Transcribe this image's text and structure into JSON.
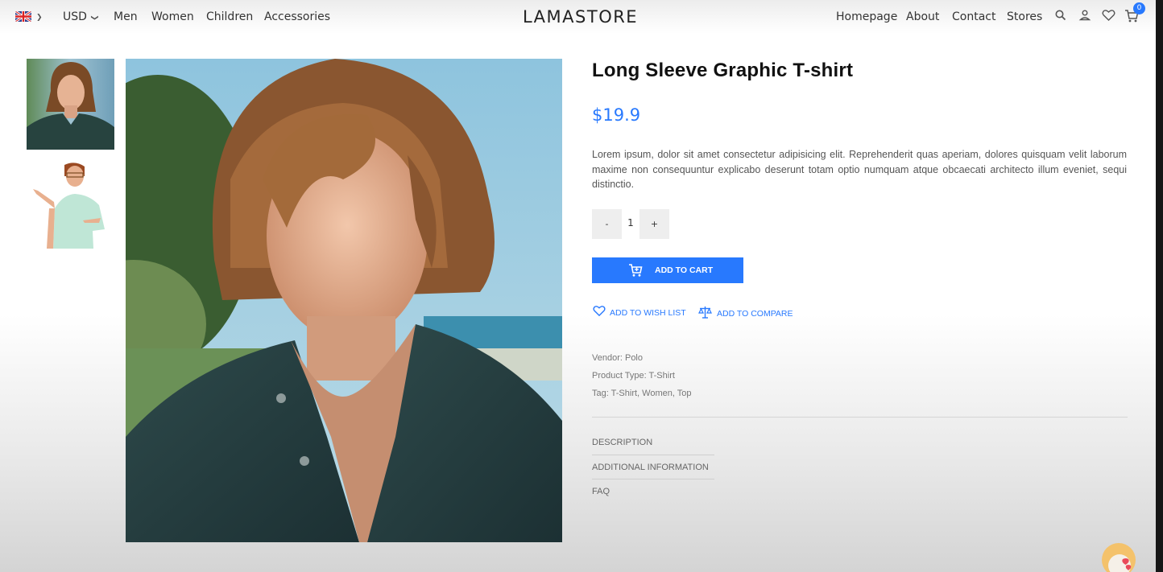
{
  "colors": {
    "accent": "#2879fe",
    "title": "#111111",
    "text": "#555555"
  },
  "nav": {
    "flag_icon": "uk-flag-icon",
    "currency": "USD",
    "left_links": [
      "Men",
      "Women",
      "Children",
      "Accessories"
    ],
    "logo": "LAMASTORE",
    "right_links": [
      "Homepage",
      "About",
      "Contact",
      "Stores"
    ],
    "icons": [
      "search-icon",
      "user-icon",
      "heart-icon",
      "cart-icon"
    ],
    "cart_count": "0"
  },
  "gallery": {
    "thumbnails": [
      "thumb-man-long-hair",
      "thumb-man-pointing"
    ],
    "main_image": "man-long-hair-dark-shirt"
  },
  "product": {
    "title": "Long Sleeve Graphic T-shirt",
    "price": "$19.9",
    "description": "Lorem ipsum, dolor sit amet consectetur adipisicing elit. Reprehenderit quas aperiam, dolores quisquam velit laborum maxime non consequuntur explicabo deserunt totam optio numquam atque obcaecati architecto illum eveniet, sequi distinctio.",
    "qty_minus": "-",
    "quantity": "1",
    "qty_plus": "+",
    "add_to_cart": "ADD TO CART",
    "wish_list": "ADD TO WISH LIST",
    "compare": "ADD TO COMPARE",
    "vendor": "Vendor: Polo",
    "product_type": "Product Type: T-Shirt",
    "tags": "Tag: T-Shirt, Women, Top"
  },
  "tabs": [
    "DESCRIPTION",
    "ADDITIONAL INFORMATION",
    "FAQ"
  ]
}
